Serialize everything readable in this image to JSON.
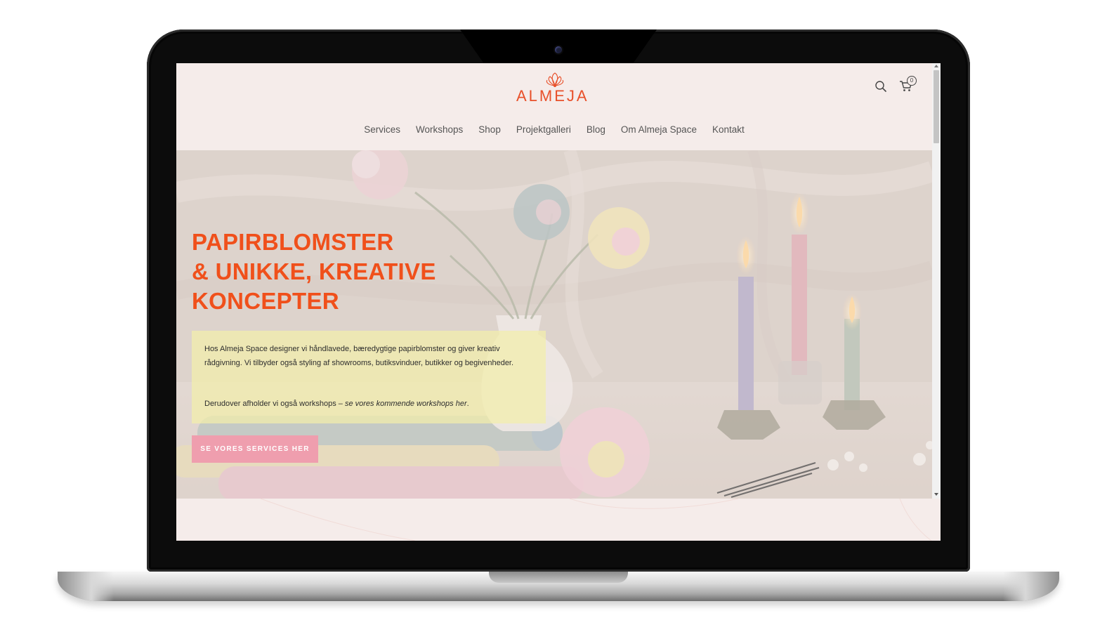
{
  "header": {
    "logo_text": "ALMEJA",
    "cart_count": "0"
  },
  "nav": {
    "items": [
      {
        "label": "Services"
      },
      {
        "label": "Workshops"
      },
      {
        "label": "Shop"
      },
      {
        "label": "Projektgalleri"
      },
      {
        "label": "Blog"
      },
      {
        "label": "Om Almeja Space"
      },
      {
        "label": "Kontakt"
      }
    ]
  },
  "hero": {
    "title_lines": [
      "PAPIRBLOMSTER",
      "& UNIKKE, KREATIVE",
      "KONCEPTER"
    ],
    "intro": "Hos Almeja Space designer vi håndlavede, bæredygtige papirblomster og giver kreativ rådgivning. Vi tilbyder også styling af showrooms, butiksvinduer, butikker og begivenheder.",
    "workshops_prefix": "Derudover afholder vi også workshops – ",
    "workshops_italic": "se vores kommende workshops",
    "workshops_link": "her",
    "workshops_suffix": ".",
    "button_label": "SE VORES SERVICES HER"
  },
  "colors": {
    "accent": "#f0501b",
    "button": "#ef9eae",
    "background": "#f5ecea",
    "intro_box": "#f2eeaa"
  }
}
